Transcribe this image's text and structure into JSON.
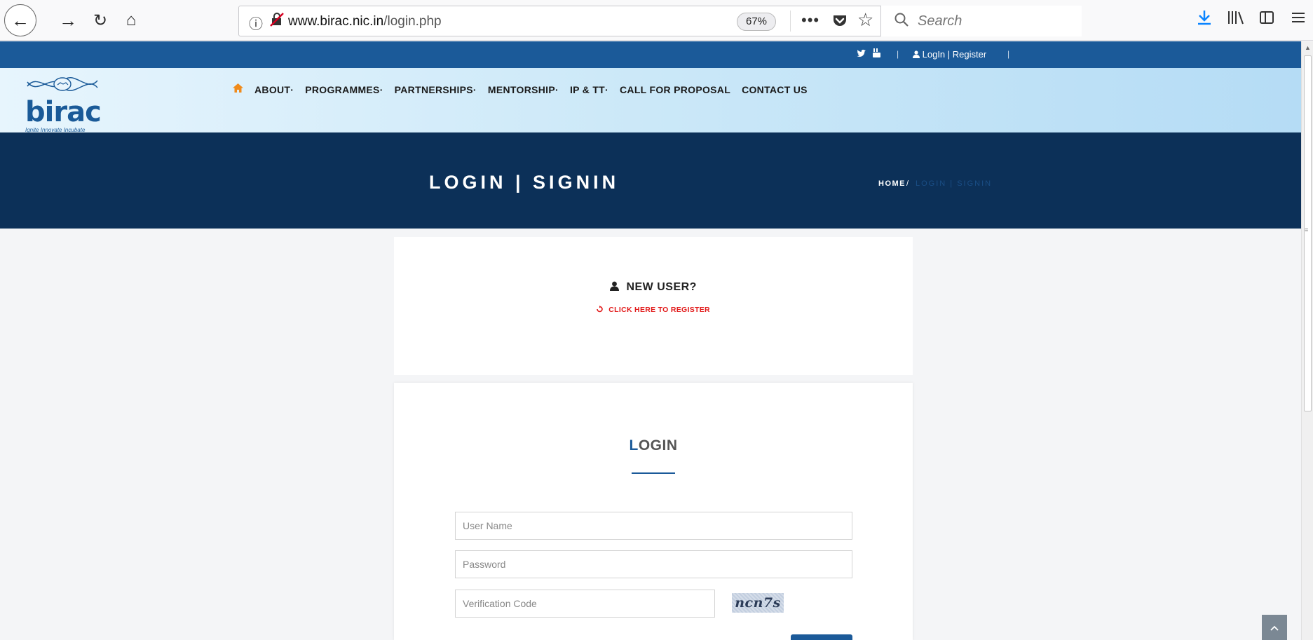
{
  "browser": {
    "url_host": "www.birac.nic.in",
    "url_path": "/login.php",
    "zoom": "67%",
    "search_placeholder": "Search",
    "icons": [
      "back-icon",
      "forward-icon",
      "reload-icon",
      "home-icon",
      "info-icon",
      "insecure-lock-icon",
      "more-icon",
      "pocket-icon",
      "bookmark-star-icon",
      "search-icon",
      "download-icon",
      "library-icon",
      "sidebar-icon",
      "menu-icon"
    ]
  },
  "topbar": {
    "social_twitter": "🐦",
    "social_youtube": "▶",
    "separator": "|",
    "login_register": "LogIn | Register",
    "separator_end": "|"
  },
  "logo": {
    "word": "birac",
    "tagline": "Ignite Innovate Incubate"
  },
  "nav": {
    "home_icon": "home-icon",
    "items": [
      "ABOUT",
      "PROGRAMMES",
      "PARTNERSHIPS",
      "MENTORSHIP",
      "IP & TT",
      "CALL FOR PROPOSAL",
      "CONTACT US"
    ],
    "dropdown_marker": "·"
  },
  "banner": {
    "title": "LOGIN | SIGNIN",
    "breadcrumb_home": "HOME",
    "breadcrumb_sep": "/",
    "breadcrumb_current": "LOGIN | SIGNIN"
  },
  "new_user": {
    "title": "NEW USER?",
    "register_link": "CLICK HERE TO REGISTER"
  },
  "login": {
    "title_first": "L",
    "title_rest": "OGIN",
    "username_placeholder": "User Name",
    "password_placeholder": "Password",
    "verification_placeholder": "Verification Code",
    "captcha_text": "ncn7s"
  },
  "colors": {
    "topbar": "#1b5a99",
    "banner": "#0c3058",
    "accent_red": "#e21b1b",
    "nav_home": "#f08a1a"
  }
}
